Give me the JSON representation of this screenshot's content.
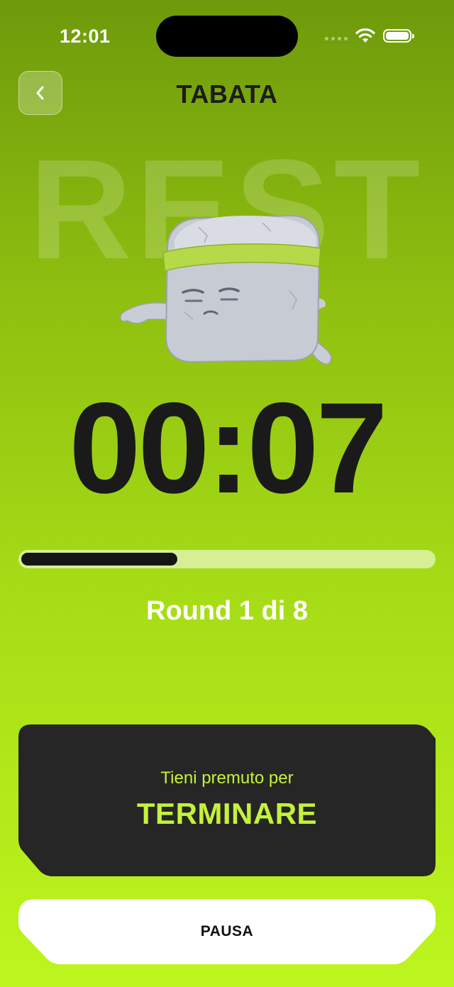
{
  "status_bar": {
    "time": "12:01",
    "battery_level": 1.0
  },
  "header": {
    "back_icon": "chevron-left-icon",
    "title": "TABATA"
  },
  "phase": {
    "label": "REST",
    "mascot": "stone-cube-mascot-resting"
  },
  "timer": {
    "value": "00:07"
  },
  "progress": {
    "fraction": 0.38
  },
  "round": {
    "text": "Round 1 di 8",
    "current": 1,
    "total": 8
  },
  "end_panel": {
    "hint": "Tieni premuto per",
    "action": "TERMINARE"
  },
  "pause_button": {
    "label": "PAUSA"
  },
  "colors": {
    "accent": "#c4f23a",
    "panel": "#262626",
    "timer": "#1a1a1a"
  }
}
